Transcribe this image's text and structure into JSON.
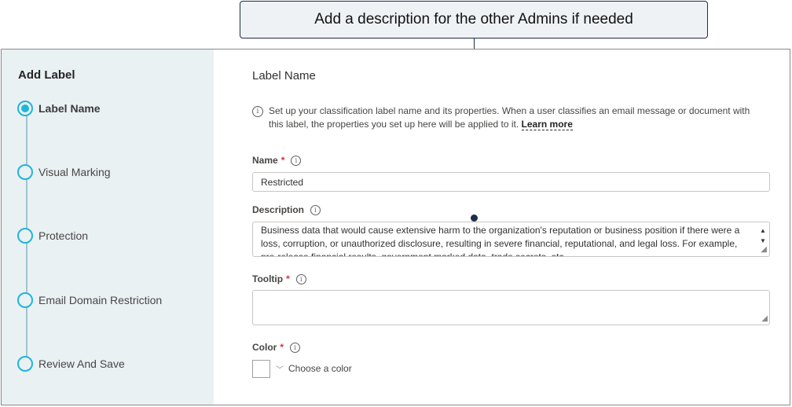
{
  "callout": {
    "text": "Add a description for the other Admins if needed"
  },
  "sidebar": {
    "title": "Add Label",
    "steps": [
      {
        "label": "Label Name",
        "active": true
      },
      {
        "label": "Visual Marking",
        "active": false
      },
      {
        "label": "Protection",
        "active": false
      },
      {
        "label": "Email Domain Restriction",
        "active": false
      },
      {
        "label": "Review And Save",
        "active": false
      }
    ]
  },
  "main": {
    "title": "Label Name",
    "info_text": "Set up your classification label name and its properties. When a user classifies an email message or document with this label, the properties you set up here will be applied to it.",
    "learn_more": "Learn more",
    "name": {
      "label": "Name",
      "required": "*",
      "value": "Restricted"
    },
    "description": {
      "label": "Description",
      "value": "Business data that would cause extensive harm to the organization's reputation or business position if there were a loss, corruption, or unauthorized disclosure, resulting in severe financial, reputational, and legal loss. For example, pre-release financial results, government marked data, trade secrets, etc."
    },
    "tooltip": {
      "label": "Tooltip",
      "required": "*",
      "value": ""
    },
    "color": {
      "label": "Color",
      "required": "*",
      "placeholder": "Choose a color"
    }
  },
  "icons": {
    "info": "info-icon",
    "chevron": "chevron-down-icon",
    "scroll_up": "scroll-up-arrow",
    "scroll_down": "scroll-down-arrow",
    "resize": "resize-grip-icon"
  },
  "colors": {
    "accent": "#22b5d6",
    "sidebar_bg": "#e9f1f3",
    "required": "#d13438",
    "callout_border": "#1f2d4a"
  }
}
